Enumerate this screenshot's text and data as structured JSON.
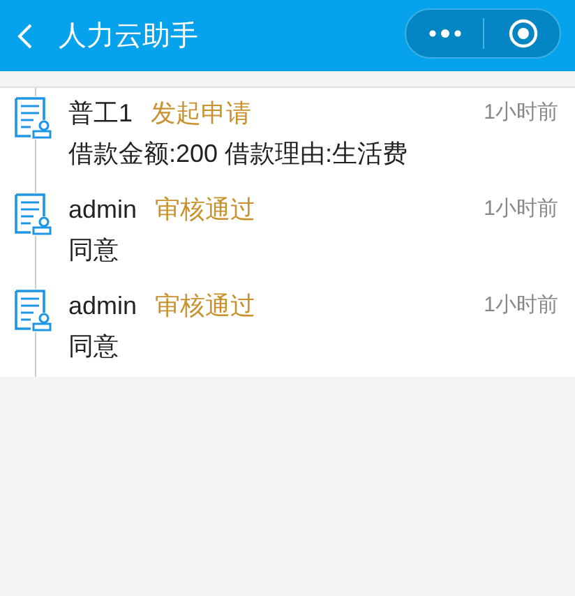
{
  "header": {
    "title": "人力云助手"
  },
  "timeline": [
    {
      "name": "普工1",
      "action": "发起申请",
      "time": "1小时前",
      "content": "借款金额:200 借款理由:生活费"
    },
    {
      "name": "admin",
      "action": "审核通过",
      "time": "1小时前",
      "content": "同意"
    },
    {
      "name": "admin",
      "action": "审核通过",
      "time": "1小时前",
      "content": "同意"
    }
  ]
}
